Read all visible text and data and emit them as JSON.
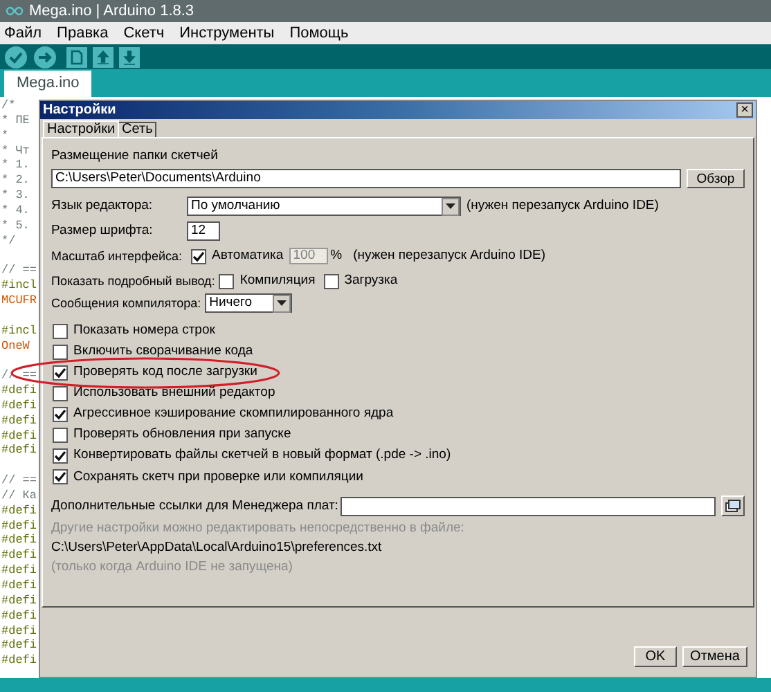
{
  "window": {
    "title": "Mega.ino | Arduino 1.8.3"
  },
  "menu": [
    "Файл",
    "Правка",
    "Скетч",
    "Инструменты",
    "Помощь"
  ],
  "file_tab": {
    "label": "Mega.ino",
    "selected": true
  },
  "editor_lines": [
    {
      "kind": "comment",
      "text": "/*"
    },
    {
      "kind": "comment",
      "text": "* ПЕ"
    },
    {
      "kind": "comment",
      "text": "*"
    },
    {
      "kind": "comment",
      "text": "* Чт"
    },
    {
      "kind": "comment",
      "text": "* 1."
    },
    {
      "kind": "comment",
      "text": "* 2."
    },
    {
      "kind": "comment",
      "text": "* 3."
    },
    {
      "kind": "comment",
      "text": "* 4."
    },
    {
      "kind": "comment",
      "text": "* 5."
    },
    {
      "kind": "comment",
      "text": "*/"
    },
    {
      "kind": "blank"
    },
    {
      "kind": "comment",
      "text": "// =="
    },
    {
      "kind": "directive",
      "text": "#incl"
    },
    {
      "kind": "type",
      "text": "MCUFR"
    },
    {
      "kind": "blank"
    },
    {
      "kind": "directive",
      "text": "#incl"
    },
    {
      "kind": "type",
      "text": "OneW"
    },
    {
      "kind": "blank"
    },
    {
      "kind": "comment",
      "text": "// =="
    },
    {
      "kind": "directive",
      "text": "#defi"
    },
    {
      "kind": "directive",
      "text": "#defi"
    },
    {
      "kind": "directive",
      "text": "#defi"
    },
    {
      "kind": "directive",
      "text": "#defi"
    },
    {
      "kind": "directive",
      "text": "#defi"
    },
    {
      "kind": "blank"
    },
    {
      "kind": "comment",
      "text": "// =="
    },
    {
      "kind": "comment",
      "text": "// Ка"
    },
    {
      "kind": "directive",
      "text": "#defi"
    },
    {
      "kind": "directive",
      "text": "#defi"
    },
    {
      "kind": "directive",
      "text": "#defi"
    },
    {
      "kind": "directive",
      "text": "#defi"
    },
    {
      "kind": "directive",
      "text": "#defi"
    },
    {
      "kind": "directive",
      "text": "#defi"
    },
    {
      "kind": "directive",
      "text": "#defi"
    },
    {
      "kind": "directive",
      "text": "#defi"
    },
    {
      "kind": "directive",
      "text": "#defi"
    },
    {
      "kind": "directive",
      "text": "#defi"
    },
    {
      "kind": "directive",
      "text": "#defi"
    }
  ],
  "dialog": {
    "title": "Настройки",
    "close": "×",
    "tabs": [
      {
        "label": "Настройки",
        "selected": true
      },
      {
        "label": "Сеть",
        "selected": false
      }
    ],
    "sketchbook": {
      "label": "Размещение папки скетчей",
      "value": "C:\\Users\\Peter\\Documents\\Arduino",
      "button": "Обзор"
    },
    "editor_language": {
      "label": "Язык редактора:",
      "value": "По умолчанию",
      "note": "(нужен перезапуск Arduino IDE)"
    },
    "font_size": {
      "label": "Размер шрифта:",
      "value": "12"
    },
    "scale": {
      "label": "Масштаб интерфейса:",
      "auto": {
        "label": "Автоматика",
        "checked": true
      },
      "value": "100",
      "disabled": true,
      "unit": "%",
      "note": "(нужен перезапуск Arduino IDE)"
    },
    "verbose": {
      "label": "Показать подробный вывод:",
      "options": [
        {
          "label": "Компиляция",
          "checked": false
        },
        {
          "label": "Загрузка",
          "checked": false
        }
      ]
    },
    "compiler_warnings": {
      "label": "Сообщения компилятора:",
      "value": "Ничего"
    },
    "options": [
      {
        "label": "Показать номера строк",
        "checked": false,
        "highlighted": false
      },
      {
        "label": "Включить сворачивание кода",
        "checked": false,
        "highlighted": false
      },
      {
        "label": "Проверять код после загрузки",
        "checked": true,
        "highlighted": true
      },
      {
        "label": "Использовать внешний редактор",
        "checked": false,
        "highlighted": false
      },
      {
        "label": "Агрессивное кэширование скомпилированного ядра",
        "checked": true,
        "highlighted": false
      },
      {
        "label": "Проверять обновления при запуске",
        "checked": false,
        "highlighted": false
      },
      {
        "label": "Конвертировать файлы скетчей в новый формат (.pde -> .ino)",
        "checked": true,
        "highlighted": false
      },
      {
        "label": "Сохранять скетч при проверке или компиляции",
        "checked": true,
        "highlighted": false
      }
    ],
    "board_urls": {
      "label": "Дополнительные ссылки для Менеджера плат:"
    },
    "notes": [
      {
        "kind": "hint",
        "text": "Другие настройки можно редактировать непосредственно в файле:"
      },
      {
        "kind": "path",
        "text": "C:\\Users\\Peter\\AppData\\Local\\Arduino15\\preferences.txt"
      },
      {
        "kind": "hint",
        "text": "(только когда Arduino IDE не запущена)"
      }
    ],
    "buttons": [
      "OK",
      "Отмена"
    ]
  }
}
